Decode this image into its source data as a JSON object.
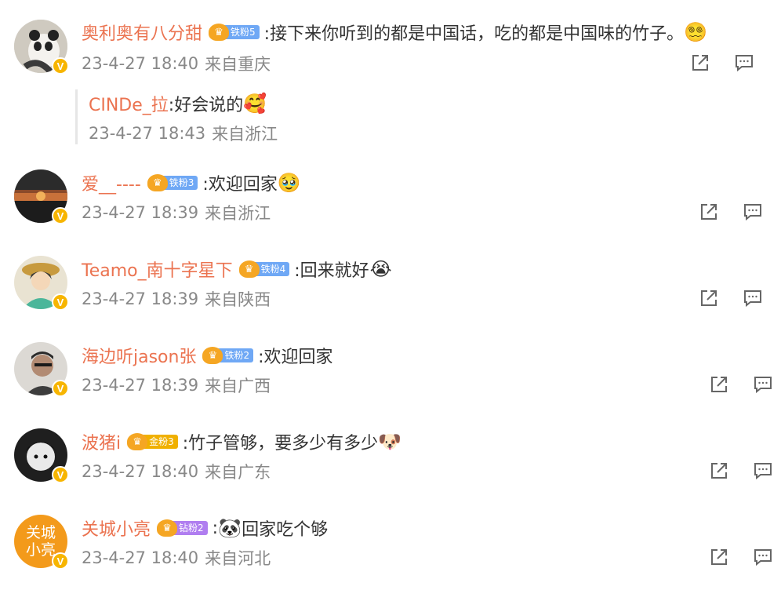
{
  "comments": [
    {
      "username": "奥利奥有八分甜",
      "fan_badge": {
        "level_text": "铁粉5",
        "color": "#6fa8f5"
      },
      "text": ":接下来你听到的都是中国话，吃的都是中国味的竹子。",
      "emoji_after": "😵‍💫",
      "date": "23-4-27 18:40",
      "location": "来自重庆",
      "avatar_icon": "panda-photo",
      "reply": {
        "username": "CINDe_拉",
        "text": ":好会说的",
        "emoji_after": "🥰",
        "date": "23-4-27 18:43",
        "location": "来自浙江"
      }
    },
    {
      "username": "爱__----",
      "fan_badge": {
        "level_text": "铁粉3",
        "color": "#6fa8f5"
      },
      "text": ":欢迎回家",
      "emoji_after": "🥹",
      "date": "23-4-27 18:39",
      "location": "来自浙江",
      "avatar_icon": "sunset-photo"
    },
    {
      "username": "Teamo_南十字星下",
      "fan_badge": {
        "level_text": "铁粉4",
        "color": "#6fa8f5"
      },
      "text": ":回来就好",
      "emoji_after": "😭",
      "date": "23-4-27 18:39",
      "location": "来自陕西",
      "avatar_icon": "anime-avatar"
    },
    {
      "username": "海边听jason张",
      "fan_badge": {
        "level_text": "铁粉2",
        "color": "#6fa8f5"
      },
      "text": ":欢迎回家",
      "emoji_after": "",
      "date": "23-4-27 18:39",
      "location": "来自广西",
      "avatar_icon": "person-photo"
    },
    {
      "username": "波猪i",
      "fan_badge": {
        "level_text": "金粉3",
        "color": "#f0b000"
      },
      "text": ":竹子管够，要多少有多少",
      "emoji_after": "🐶",
      "date": "23-4-27 18:40",
      "location": "来自广东",
      "avatar_icon": "dark-avatar"
    },
    {
      "username": "关城小亮",
      "fan_badge": {
        "level_text": "钻粉2",
        "color": "#b07ef0"
      },
      "text_before": ":",
      "emoji_inline": "🐼",
      "text": "回家吃个够",
      "date": "23-4-27 18:40",
      "location": "来自河北",
      "avatar_icon": "calligraphy-avatar",
      "avatar_text": "关城\n小亮"
    }
  ],
  "colors": {
    "username": "#eb7350",
    "meta": "#888888",
    "text": "#333333",
    "verified_badge": "#f7b500"
  },
  "actions": [
    "share-icon",
    "comment-icon"
  ]
}
